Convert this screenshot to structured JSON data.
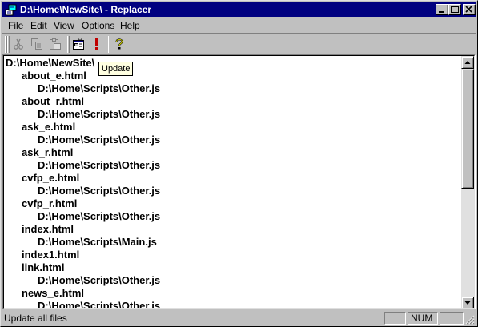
{
  "window": {
    "title": "D:\\Home\\NewSite\\ - Replacer"
  },
  "menu": {
    "items": [
      "File",
      "Edit",
      "View",
      "Options",
      "Help"
    ]
  },
  "toolbar": {
    "buttons": [
      {
        "name": "cut",
        "icon": "scissors-icon",
        "enabled": false
      },
      {
        "name": "copy",
        "icon": "copy-icon",
        "enabled": false
      },
      {
        "name": "paste",
        "icon": "paste-icon",
        "enabled": false
      },
      {
        "name": "properties",
        "icon": "properties-icon",
        "enabled": true
      },
      {
        "name": "update",
        "icon": "exclamation-icon",
        "enabled": true
      },
      {
        "name": "help",
        "icon": "help-question-icon",
        "enabled": true
      }
    ],
    "tooltip": "Update"
  },
  "tree": {
    "root": "D:\\Home\\NewSite\\",
    "items": [
      {
        "file": "about_e.html",
        "script": "D:\\Home\\Scripts\\Other.js"
      },
      {
        "file": "about_r.html",
        "script": "D:\\Home\\Scripts\\Other.js"
      },
      {
        "file": "ask_e.html",
        "script": "D:\\Home\\Scripts\\Other.js"
      },
      {
        "file": "ask_r.html",
        "script": "D:\\Home\\Scripts\\Other.js"
      },
      {
        "file": "cvfp_e.html",
        "script": "D:\\Home\\Scripts\\Other.js"
      },
      {
        "file": "cvfp_r.html",
        "script": "D:\\Home\\Scripts\\Other.js"
      },
      {
        "file": "index.html",
        "script": "D:\\Home\\Scripts\\Main.js"
      },
      {
        "file": "index1.html",
        "script": null
      },
      {
        "file": "link.html",
        "script": "D:\\Home\\Scripts\\Other.js"
      },
      {
        "file": "news_e.html",
        "script": "D:\\Home\\Scripts\\Other.js"
      }
    ]
  },
  "status": {
    "message": "Update all files",
    "num": "NUM"
  },
  "colors": {
    "titlebar": "#000080",
    "face": "#c0c0c0",
    "tooltip_bg": "#ffffe1",
    "update_icon": "#c00000"
  }
}
